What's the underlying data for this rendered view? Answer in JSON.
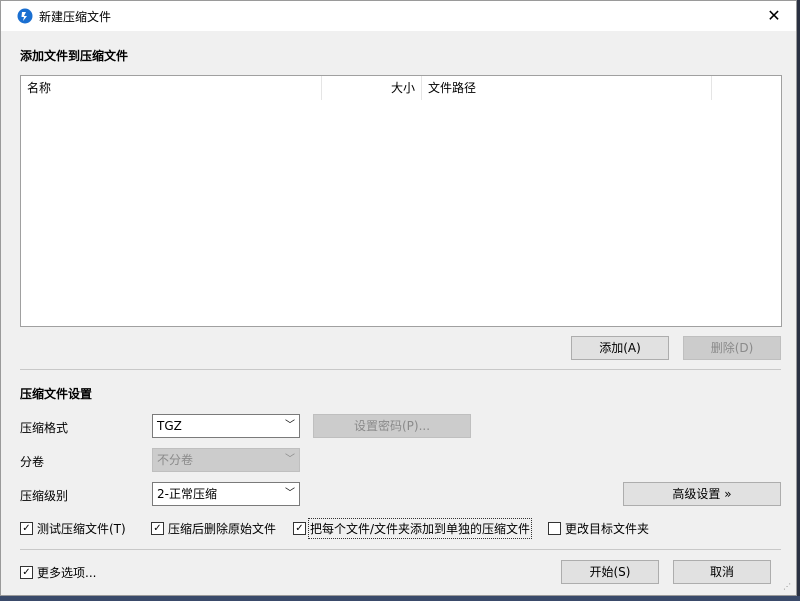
{
  "window": {
    "title": "新建压缩文件",
    "close_icon": "close-icon",
    "app_icon": "app-icon"
  },
  "files_section": {
    "label": "添加文件到压缩文件",
    "columns": [
      "名称",
      "大小",
      "文件路径"
    ],
    "add_button": "添加(A)",
    "delete_button": "删除(D)"
  },
  "settings": {
    "label": "压缩文件设置",
    "format_label": "压缩格式",
    "format_value": "TGZ",
    "password_button": "设置密码(P)...",
    "split_label": "分卷",
    "split_value": "不分卷",
    "level_label": "压缩级别",
    "level_value": "2-正常压缩",
    "advanced_button": "高级设置 »"
  },
  "options": {
    "test": {
      "label": "测试压缩文件(T)",
      "checked": true
    },
    "delete_after": {
      "label": "压缩后删除原始文件",
      "checked": true
    },
    "separate": {
      "label": "把每个文件/文件夹添加到单独的压缩文件",
      "checked": true
    },
    "change_target": {
      "label": "更改目标文件夹",
      "checked": false
    }
  },
  "footer": {
    "more_options": {
      "label": "更多选项...",
      "checked": true
    },
    "start_button": "开始(S)",
    "cancel_button": "取消"
  }
}
